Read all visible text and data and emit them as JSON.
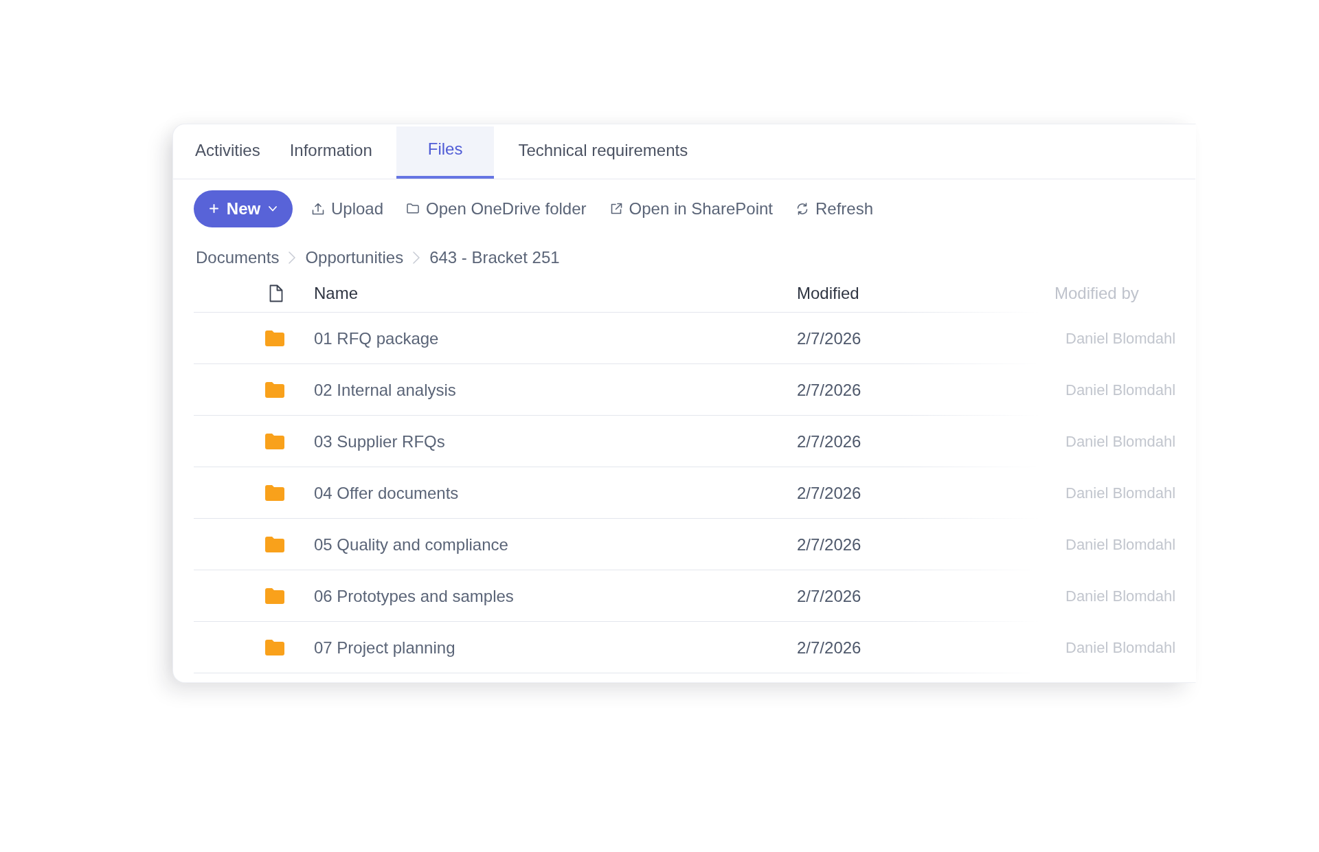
{
  "tabs": [
    {
      "label": "Activities",
      "selected": false
    },
    {
      "label": "Information",
      "selected": false
    },
    {
      "label": "Files",
      "selected": true
    },
    {
      "label": "Technical requirements",
      "selected": false
    }
  ],
  "toolbar": {
    "new_button": {
      "label": "New"
    },
    "actions": [
      {
        "label": "Upload",
        "kind": "upload"
      },
      {
        "label": "Open OneDrive folder",
        "kind": "folder"
      },
      {
        "label": "Open in SharePoint",
        "kind": "external"
      },
      {
        "label": "Refresh",
        "kind": "refresh"
      }
    ]
  },
  "breadcrumb": [
    {
      "label": "Documents"
    },
    {
      "label": "Opportunities"
    },
    {
      "label": "643 - Bracket 251"
    }
  ],
  "table": {
    "columns": [
      "Name",
      "Modified",
      "Modified by"
    ],
    "rows": [
      {
        "name": "01 RFQ package",
        "modified": "2/7/2026",
        "modified_by": "Daniel Blomdahl"
      },
      {
        "name": "02 Internal analysis",
        "modified": "2/7/2026",
        "modified_by": "Daniel Blomdahl"
      },
      {
        "name": "03 Supplier RFQs",
        "modified": "2/7/2026",
        "modified_by": "Daniel Blomdahl"
      },
      {
        "name": "04 Offer documents",
        "modified": "2/7/2026",
        "modified_by": "Daniel Blomdahl"
      },
      {
        "name": "05 Quality and compliance",
        "modified": "2/7/2026",
        "modified_by": "Daniel Blomdahl"
      },
      {
        "name": "06 Prototypes and samples",
        "modified": "2/7/2026",
        "modified_by": "Daniel Blomdahl"
      },
      {
        "name": "07 Project planning",
        "modified": "2/7/2026",
        "modified_by": "Daniel Blomdahl"
      }
    ]
  }
}
